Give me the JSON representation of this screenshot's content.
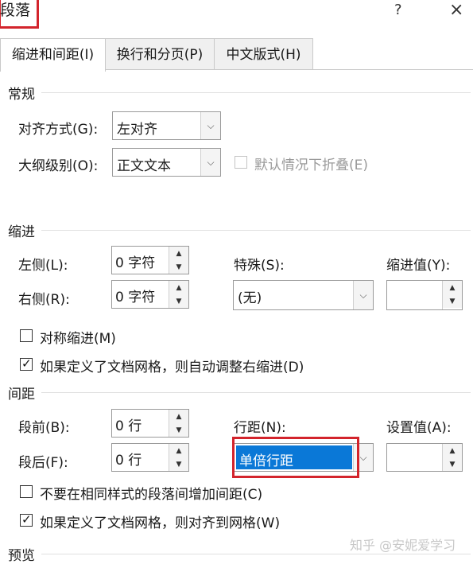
{
  "dialog": {
    "title": "段落",
    "help": "?",
    "close": "×"
  },
  "tabs": [
    {
      "label": "缩进和间距(I)"
    },
    {
      "label": "换行和分页(P)"
    },
    {
      "label": "中文版式(H)"
    }
  ],
  "general": {
    "heading": "常规",
    "alignment_label": "对齐方式(G):",
    "alignment_value": "左对齐",
    "outline_label": "大纲级别(O):",
    "outline_value": "正文文本",
    "collapse_label": "默认情况下折叠(E)"
  },
  "indent": {
    "heading": "缩进",
    "left_label": "左侧(L):",
    "left_value": "0 字符",
    "right_label": "右侧(R):",
    "right_value": "0 字符",
    "special_label": "特殊(S):",
    "special_value": "(无)",
    "by_label": "缩进值(Y):",
    "by_value": "",
    "mirror_label": "对称缩进(M)",
    "auto_adjust_label": "如果定义了文档网格，则自动调整右缩进(D)"
  },
  "spacing": {
    "heading": "间距",
    "before_label": "段前(B):",
    "before_value": "0 行",
    "after_label": "段后(F):",
    "after_value": "0 行",
    "line_label": "行距(N):",
    "line_value": "单倍行距",
    "at_label": "设置值(A):",
    "at_value": "",
    "no_space_label": "不要在相同样式的段落间增加间距(C)",
    "snap_grid_label": "如果定义了文档网格，则对齐到网格(W)"
  },
  "preview": {
    "heading": "预览"
  },
  "watermark": "知乎 @安妮爱学习",
  "colors": {
    "highlight": "#0a78d7",
    "callout": "#d3242c"
  }
}
